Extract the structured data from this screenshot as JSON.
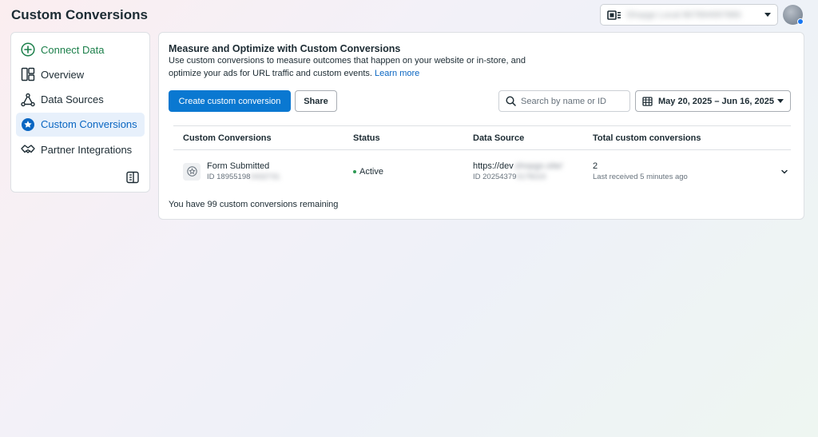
{
  "header": {
    "title": "Custom Conversions",
    "account_name": "Shopgo Local 867894997880"
  },
  "sidebar": {
    "items": [
      {
        "label": "Connect Data"
      },
      {
        "label": "Overview"
      },
      {
        "label": "Data Sources"
      },
      {
        "label": "Custom Conversions"
      },
      {
        "label": "Partner Integrations"
      }
    ]
  },
  "main": {
    "headline": "Measure and Optimize with Custom Conversions",
    "description": "Use custom conversions to measure outcomes that happen on your website or in-store, and optimize your ads for URL traffic and custom events.",
    "learn_more": "Learn more",
    "create_button": "Create custom conversion",
    "share_button": "Share",
    "search_placeholder": "Search by name or ID",
    "date_range": "May 20, 2025 – Jun 16, 2025",
    "table": {
      "headers": [
        "Custom Conversions",
        "Status",
        "Data Source",
        "Total custom conversions"
      ],
      "rows": [
        {
          "name": "Form Submitted",
          "id_prefix": "ID 18955198",
          "id_rest": "0432731",
          "status": "Active",
          "source_prefix": "https://dev",
          "source_rest": ".shopgo.site/",
          "source_id_prefix": "ID 20254379",
          "source_id_rest": "0178223",
          "total": "2",
          "last_received": "Last received 5 minutes ago"
        }
      ]
    },
    "remaining": "You have 99 custom conversions remaining"
  },
  "colors": {
    "primary": "#0a78d1",
    "active_nav_bg": "#e7f0fb",
    "active_nav_text": "#0a66c2",
    "connect_green": "#1b7f4a",
    "status_green": "#2e9a55"
  }
}
